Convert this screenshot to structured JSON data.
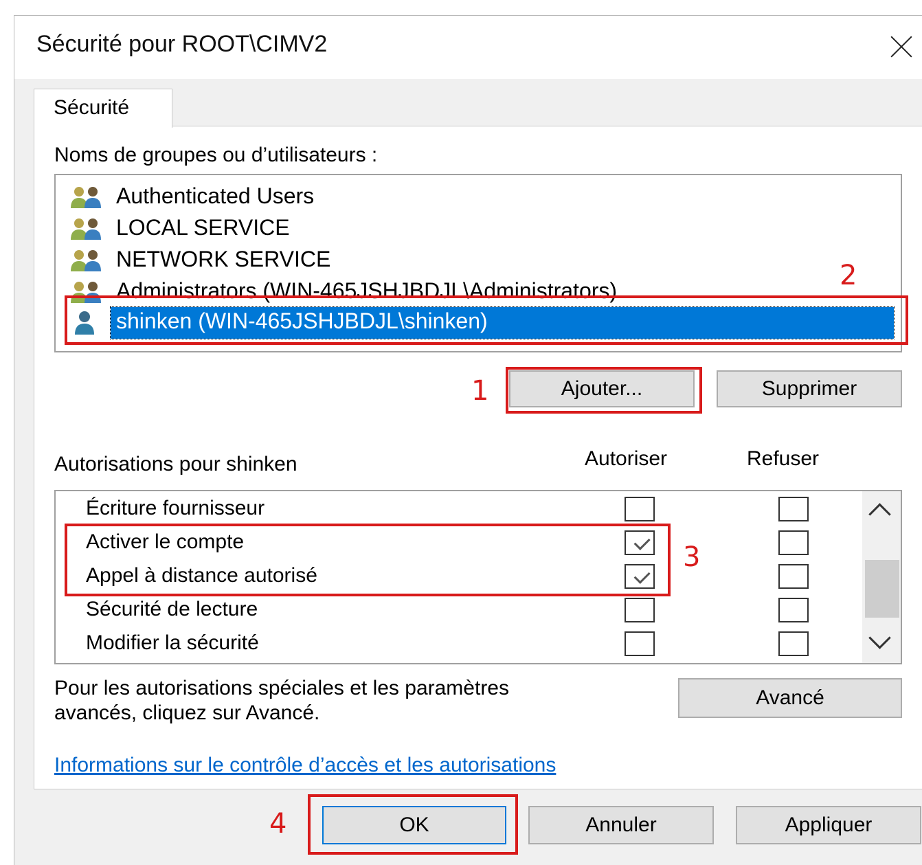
{
  "window": {
    "title": "Sécurité pour ROOT\\CIMV2",
    "close_icon": "close-icon"
  },
  "tabs": [
    {
      "label": "Sécurité",
      "active": true
    }
  ],
  "users_section": {
    "label": "Noms de groupes ou d’utilisateurs :",
    "users": [
      {
        "name": "Authenticated Users",
        "icon": "group-icon"
      },
      {
        "name": "LOCAL SERVICE",
        "icon": "group-icon"
      },
      {
        "name": "NETWORK SERVICE",
        "icon": "group-icon"
      },
      {
        "name": "Administrators (WIN-465JSHJBDJL\\Administrators)",
        "icon": "group-icon"
      },
      {
        "name": "shinken (WIN-465JSHJBDJL\\shinken)",
        "icon": "user-icon",
        "selected": true
      }
    ],
    "add_button": "Ajouter...",
    "remove_button": "Supprimer"
  },
  "permissions_section": {
    "label": "Autorisations pour shinken",
    "allow_header": "Autoriser",
    "deny_header": "Refuser",
    "permissions": [
      {
        "name": "Écriture fournisseur",
        "allow": false,
        "deny": false
      },
      {
        "name": "Activer le compte",
        "allow": true,
        "deny": false
      },
      {
        "name": "Appel à distance autorisé",
        "allow": true,
        "deny": false
      },
      {
        "name": "Sécurité de lecture",
        "allow": false,
        "deny": false
      },
      {
        "name": "Modifier la sécurité",
        "allow": false,
        "deny": false
      }
    ]
  },
  "advanced": {
    "text_line1": "Pour les autorisations spéciales et les paramètres",
    "text_line2": "avancés, cliquez sur Avancé.",
    "button": "Avancé"
  },
  "help_link": "Informations sur le contrôle d’accès et les autorisations",
  "footer": {
    "ok": "OK",
    "cancel": "Annuler",
    "apply": "Appliquer"
  },
  "annotations": {
    "step1": "1",
    "step2": "2",
    "step3": "3",
    "step4": "4",
    "color": "#d81b1b"
  },
  "colors": {
    "selection": "#0078d7",
    "link": "#0066cc",
    "dialog_bg": "#f0f0f0"
  }
}
